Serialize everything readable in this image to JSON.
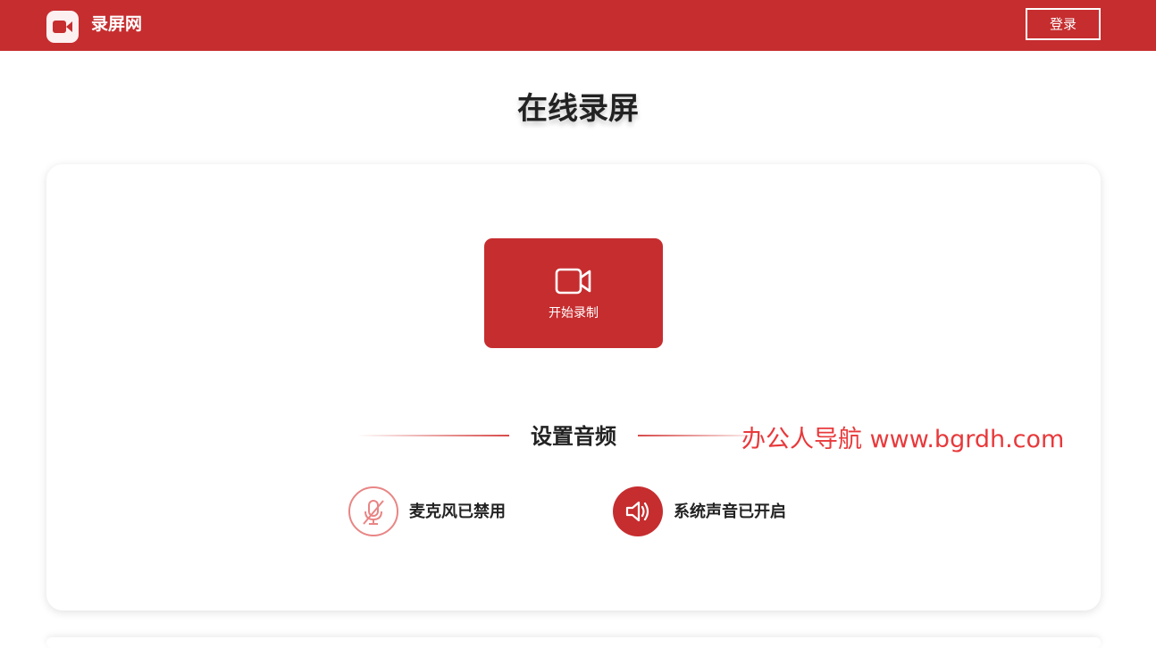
{
  "header": {
    "brand_name": "录屏网",
    "brand_icon": "video-camera-icon",
    "login_label": "登录"
  },
  "main": {
    "title": "在线录屏",
    "record_button": {
      "label": "开始录制",
      "icon": "video-camera-icon"
    },
    "audio_section": {
      "title": "设置音频",
      "microphone": {
        "label": "麦克风已禁用",
        "icon": "microphone-off-icon"
      },
      "system_sound": {
        "label": "系统声音已开启",
        "icon": "speaker-on-icon"
      }
    }
  },
  "watermark": {
    "text": "办公人导航 www.bgrdh.com"
  },
  "colors": {
    "brand_red": "#c62d2f",
    "mic_disabled_pink": "#e98585",
    "watermark_red": "#e8393b"
  }
}
